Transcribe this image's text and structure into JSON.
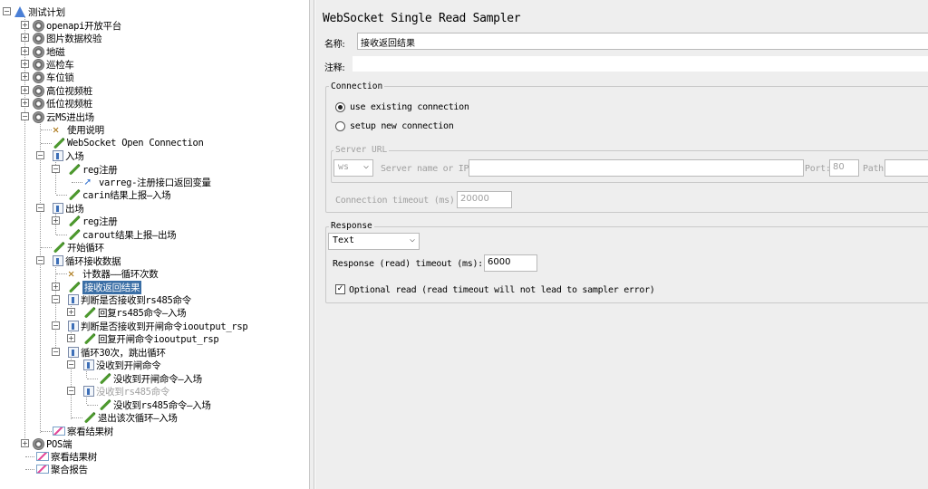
{
  "tree": {
    "root": "测试计划",
    "items": [
      {
        "label": "openapi开放平台",
        "icon": "gear-icon"
      },
      {
        "label": "图片数据校验",
        "icon": "gear-icon"
      },
      {
        "label": "地磁",
        "icon": "gear-icon"
      },
      {
        "label": "巡检车",
        "icon": "gear-icon"
      },
      {
        "label": "车位锁",
        "icon": "gear-icon"
      },
      {
        "label": "高位视频桩",
        "icon": "gear-icon"
      },
      {
        "label": "低位视频桩",
        "icon": "gear-icon"
      },
      {
        "label": "云MS进出场",
        "icon": "gear-icon"
      },
      {
        "label": "使用说明",
        "icon": "tools-icon"
      },
      {
        "label": "WebSocket Open Connection",
        "icon": "pen-icon"
      },
      {
        "label": "入场",
        "icon": "controller-icon"
      },
      {
        "label": "reg注册",
        "icon": "pen-icon"
      },
      {
        "label": "varreg-注册接口返回变量",
        "icon": "arrow-icon"
      },
      {
        "label": "carin结果上报—入场",
        "icon": "pen-icon"
      },
      {
        "label": "出场",
        "icon": "controller-icon"
      },
      {
        "label": "reg注册",
        "icon": "pen-icon"
      },
      {
        "label": "carout结果上报—出场",
        "icon": "pen-icon"
      },
      {
        "label": "开始循环",
        "icon": "pen-icon"
      },
      {
        "label": "循环接收数据",
        "icon": "controller-icon"
      },
      {
        "label": "计数器——循环次数",
        "icon": "tools-icon"
      },
      {
        "label": "接收返回结果",
        "icon": "pen-icon"
      },
      {
        "label": "判断是否接收到rs485命令",
        "icon": "controller-icon"
      },
      {
        "label": "回复rs485命令—入场",
        "icon": "pen-icon"
      },
      {
        "label": "判断是否接收到开闸命令iooutput_rsp",
        "icon": "controller-icon"
      },
      {
        "label": "回复开闸命令iooutput_rsp",
        "icon": "pen-icon"
      },
      {
        "label": "循环30次，跳出循环",
        "icon": "controller-icon"
      },
      {
        "label": "没收到开闸命令",
        "icon": "controller-icon"
      },
      {
        "label": "没收到开闸命令—入场",
        "icon": "pen-icon"
      },
      {
        "label": "没收到rs485命令",
        "icon": "controller-icon"
      },
      {
        "label": "没收到rs485命令—入场",
        "icon": "pen-icon"
      },
      {
        "label": "退出该次循环—入场",
        "icon": "pen-icon"
      },
      {
        "label": "察看结果树",
        "icon": "chart-icon"
      },
      {
        "label": "POS端",
        "icon": "gear-icon"
      },
      {
        "label": "察看结果树",
        "icon": "chart-icon"
      },
      {
        "label": "聚合报告",
        "icon": "chart-icon"
      }
    ]
  },
  "panel": {
    "title": "WebSocket Single Read Sampler",
    "name_label": "名称:",
    "name_value": "接收返回结果",
    "comment_label": "注释:",
    "comment_value": "",
    "connection": {
      "group_title": "Connection",
      "option_existing": "use existing connection",
      "option_new": "setup new connection",
      "selected": "use existing connection",
      "server_url_title": "Server URL",
      "protocol": "ws",
      "server_label": "Server name or IP:",
      "server_value": "",
      "port_label": "Port:",
      "port_value": "80",
      "path_label": "Path:",
      "path_value": "",
      "timeout_label": "Connection timeout (ms):",
      "timeout_value": "20000"
    },
    "response": {
      "group_title": "Response",
      "type": "Text",
      "read_timeout_label": "Response (read) timeout (ms):",
      "read_timeout_value": "6000",
      "optional_read_label": "Optional read (read timeout will not lead to sampler error)",
      "optional_read_checked": true
    }
  }
}
